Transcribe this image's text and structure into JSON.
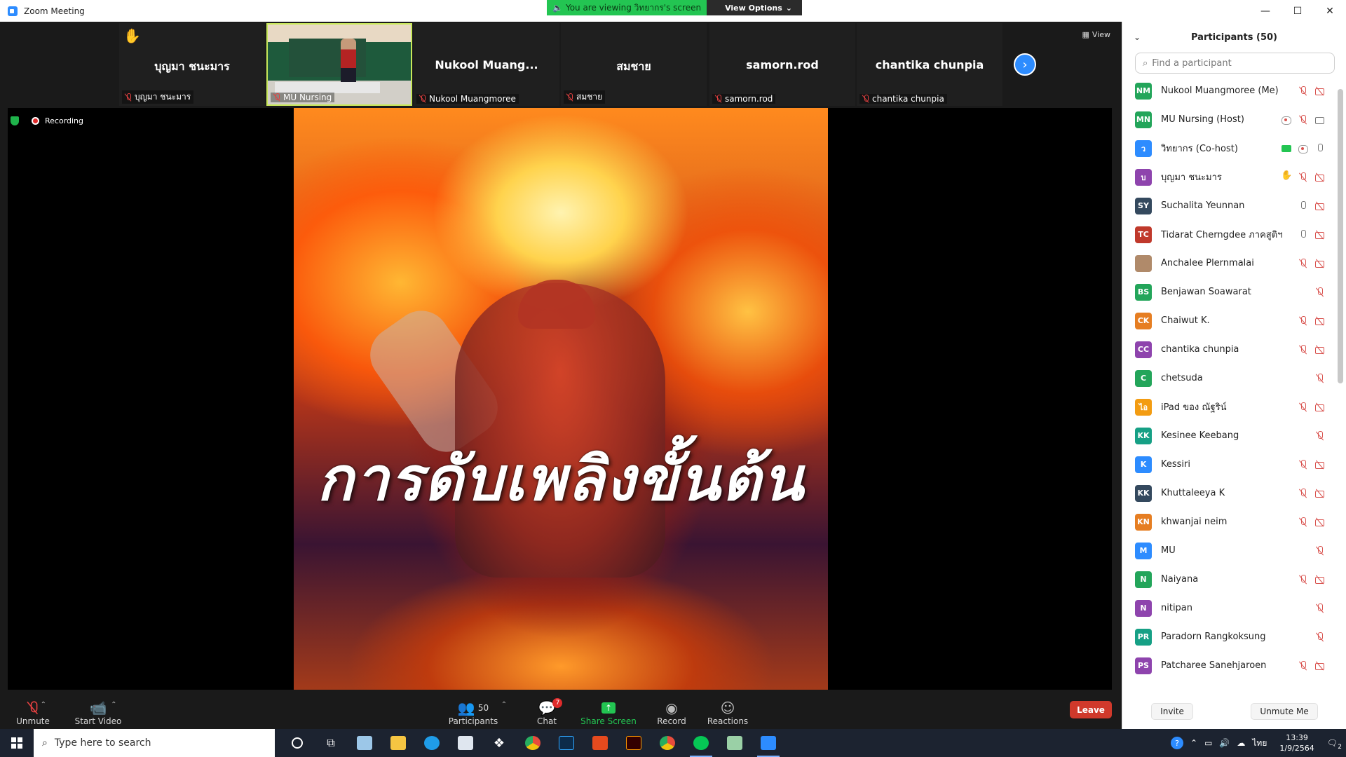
{
  "window": {
    "title": "Zoom Meeting"
  },
  "banner": {
    "viewing": "You are viewing วิทยากร's screen",
    "view_options": "View Options"
  },
  "strip": {
    "view_label": "View",
    "tiles": [
      {
        "name": "บุญมา ชนะมาร",
        "label": "บุญมา ชนะมาร"
      },
      {
        "name": "",
        "label": "MU Nursing"
      },
      {
        "name": "Nukool  Muang...",
        "label": "Nukool Muangmoree"
      },
      {
        "name": "สมชาย",
        "label": "สมชาย"
      },
      {
        "name": "samorn.rod",
        "label": "samorn.rod"
      },
      {
        "name": "chantika chunpia",
        "label": "chantika chunpia"
      }
    ]
  },
  "share": {
    "recording": "Recording",
    "slide_text": "การดับเพลิงขั้นต้น"
  },
  "toolbar": {
    "unmute": "Unmute",
    "start_video": "Start Video",
    "participants": "Participants",
    "participants_count": "50",
    "chat": "Chat",
    "chat_badge": "7",
    "share_screen": "Share Screen",
    "record": "Record",
    "reactions": "Reactions",
    "leave": "Leave"
  },
  "panel": {
    "title": "Participants (50)",
    "search_placeholder": "Find a participant",
    "invite": "Invite",
    "unmute_me": "Unmute Me",
    "participants": [
      {
        "initials": "NM",
        "color": "#23a55a",
        "name": "Nukool Muangmoree (Me)",
        "icons": [
          "mic-off",
          "vid-off"
        ]
      },
      {
        "initials": "MN",
        "color": "#23a55a",
        "name": "MU Nursing (Host)",
        "icons": [
          "rec",
          "mic-off",
          "vid-on"
        ]
      },
      {
        "initials": "ว",
        "color": "#2d8cff",
        "name": "วิทยากร (Co-host)",
        "icons": [
          "share-ic",
          "rec",
          "mic-on"
        ]
      },
      {
        "initials": "บ",
        "color": "#8e44ad",
        "name": "บุญมา ชนะมาร",
        "icons": [
          "hand-ic",
          "mic-off",
          "vid-off"
        ]
      },
      {
        "initials": "SY",
        "color": "#34495e",
        "name": "Suchalita Yeunnan",
        "icons": [
          "mic-on",
          "vid-off"
        ]
      },
      {
        "initials": "TC",
        "color": "#c0392b",
        "name": "Tidarat Cherngdee ภาคสูติฯ",
        "icons": [
          "mic-on",
          "vid-off"
        ]
      },
      {
        "initials": "",
        "color": "#b08a6a",
        "name": "Anchalee Plernmalai",
        "icons": [
          "mic-off",
          "vid-off"
        ]
      },
      {
        "initials": "BS",
        "color": "#23a55a",
        "name": "Benjawan  Soawarat",
        "icons": [
          "mic-off"
        ]
      },
      {
        "initials": "CK",
        "color": "#e67e22",
        "name": "Chaiwut K.",
        "icons": [
          "mic-off",
          "vid-off"
        ]
      },
      {
        "initials": "CC",
        "color": "#8e44ad",
        "name": "chantika chunpia",
        "icons": [
          "mic-off",
          "vid-off"
        ]
      },
      {
        "initials": "C",
        "color": "#23a55a",
        "name": "chetsuda",
        "icons": [
          "mic-off"
        ]
      },
      {
        "initials": "ไอ",
        "color": "#f39c12",
        "name": "iPad ของ ณัฐริน์",
        "icons": [
          "mic-off",
          "vid-off"
        ]
      },
      {
        "initials": "KK",
        "color": "#16a085",
        "name": "Kesinee Keebang",
        "icons": [
          "mic-off"
        ]
      },
      {
        "initials": "K",
        "color": "#2d8cff",
        "name": "Kessiri",
        "icons": [
          "mic-off",
          "vid-off"
        ]
      },
      {
        "initials": "KK",
        "color": "#34495e",
        "name": "Khuttaleeya K",
        "icons": [
          "mic-off",
          "vid-off"
        ]
      },
      {
        "initials": "KN",
        "color": "#e67e22",
        "name": "khwanjai neim",
        "icons": [
          "mic-off",
          "vid-off"
        ]
      },
      {
        "initials": "M",
        "color": "#2d8cff",
        "name": "MU",
        "icons": [
          "mic-off"
        ]
      },
      {
        "initials": "N",
        "color": "#23a55a",
        "name": "Naiyana",
        "icons": [
          "mic-off",
          "vid-off"
        ]
      },
      {
        "initials": "N",
        "color": "#8e44ad",
        "name": "nitipan",
        "icons": [
          "mic-off"
        ]
      },
      {
        "initials": "PR",
        "color": "#16a085",
        "name": "Paradorn Rangkoksung",
        "icons": [
          "mic-off"
        ]
      },
      {
        "initials": "PS",
        "color": "#8e44ad",
        "name": "Patcharee Sanehjaroen",
        "icons": [
          "mic-off",
          "vid-off"
        ]
      }
    ]
  },
  "taskbar": {
    "search_placeholder": "Type here to search",
    "lang": "ไทย",
    "time": "13:39",
    "date": "1/9/2564",
    "notif_count": "2"
  }
}
